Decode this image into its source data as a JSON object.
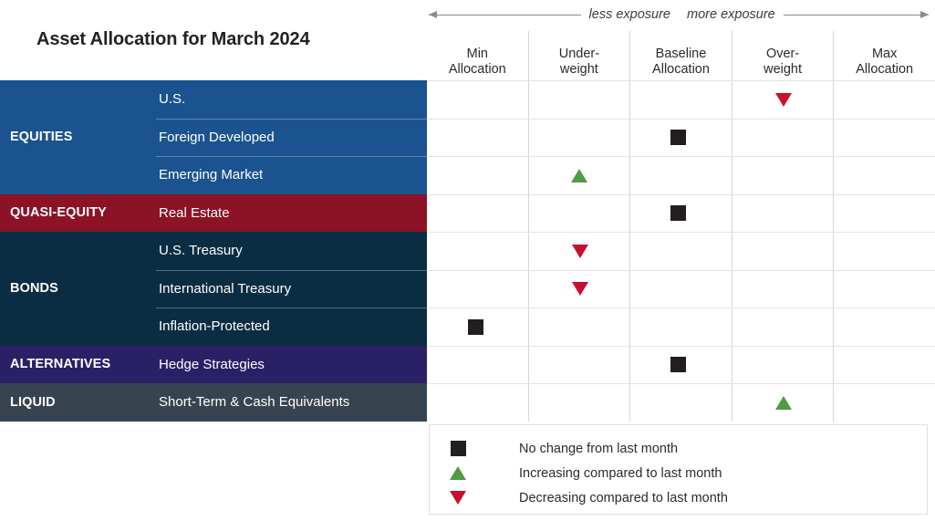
{
  "chart_data": {
    "type": "table",
    "title": "Asset Allocation for March 2024",
    "xlabel": "",
    "ylabel": "",
    "grid": true,
    "legend_position": "bottom-right",
    "axis_direction": {
      "left_label": "less exposure",
      "right_label": "more exposure",
      "left_arrow_icon": "arrow-left-icon",
      "right_arrow_icon": "arrow-right-icon"
    },
    "categories": [
      "Min\nAllocation",
      "Under-\nweight",
      "Baseline\nAllocation",
      "Over-\nweight",
      "Max\nAllocation"
    ],
    "series": [
      {
        "name": "U.S.",
        "group": "EQUITIES",
        "column": "Over-weight",
        "column_index": 3,
        "marker": "down",
        "value": 4
      },
      {
        "name": "Foreign Developed",
        "group": "EQUITIES",
        "column": "Baseline Allocation",
        "column_index": 2,
        "marker": "square",
        "value": 3
      },
      {
        "name": "Emerging Market",
        "group": "EQUITIES",
        "column": "Under-weight",
        "column_index": 1,
        "marker": "up",
        "value": 2
      },
      {
        "name": "Real Estate",
        "group": "QUASI-EQUITY",
        "column": "Baseline Allocation",
        "column_index": 2,
        "marker": "square",
        "value": 3
      },
      {
        "name": "U.S. Treasury",
        "group": "BONDS",
        "column": "Under-weight",
        "column_index": 1,
        "marker": "down",
        "value": 2
      },
      {
        "name": "International Treasury",
        "group": "BONDS",
        "column": "Under-weight",
        "column_index": 1,
        "marker": "down",
        "value": 2
      },
      {
        "name": "Inflation-Protected",
        "group": "BONDS",
        "column": "Min Allocation",
        "column_index": 0,
        "marker": "square",
        "value": 1
      },
      {
        "name": "Hedge Strategies",
        "group": "ALTERNATIVES",
        "column": "Baseline Allocation",
        "column_index": 2,
        "marker": "square",
        "value": 3
      },
      {
        "name": "Short-Term & Cash Equivalents",
        "group": "LIQUID",
        "column": "Over-weight",
        "column_index": 3,
        "marker": "up",
        "value": 4
      }
    ]
  },
  "title": "Asset Allocation for March 2024",
  "exposure": {
    "less": "less exposure",
    "more": "more exposure"
  },
  "columns": [
    {
      "line1": "Min",
      "line2": "Allocation"
    },
    {
      "line1": "Under-",
      "line2": "weight"
    },
    {
      "line1": "Baseline",
      "line2": "Allocation"
    },
    {
      "line1": "Over-",
      "line2": "weight"
    },
    {
      "line1": "Max",
      "line2": "Allocation"
    }
  ],
  "groups": [
    {
      "label": "EQUITIES",
      "color": "#1a538f",
      "rows": 3
    },
    {
      "label": "QUASI-EQUITY",
      "color": "#8c1226",
      "rows": 1
    },
    {
      "label": "BONDS",
      "color": "#0b2d43",
      "rows": 3
    },
    {
      "label": "ALTERNATIVES",
      "color": "#2a2066",
      "rows": 1
    },
    {
      "label": "LIQUID",
      "color": "#374450",
      "rows": 1
    }
  ],
  "rows": [
    {
      "group": "EQUITIES",
      "group_label_shown": false,
      "asset": "U.S.",
      "marker": "down",
      "col": 3,
      "rule": false
    },
    {
      "group": "EQUITIES",
      "group_label_shown": true,
      "asset": "Foreign Developed",
      "marker": "square",
      "col": 2,
      "rule": true
    },
    {
      "group": "EQUITIES",
      "group_label_shown": false,
      "asset": "Emerging Market",
      "marker": "up",
      "col": 1,
      "rule": true
    },
    {
      "group": "QUASI-EQUITY",
      "group_label_shown": true,
      "asset": "Real Estate",
      "marker": "square",
      "col": 2,
      "rule": false
    },
    {
      "group": "BONDS",
      "group_label_shown": false,
      "asset": "U.S. Treasury",
      "marker": "down",
      "col": 1,
      "rule": false
    },
    {
      "group": "BONDS",
      "group_label_shown": true,
      "asset": "International Treasury",
      "marker": "down",
      "col": 1,
      "rule": true
    },
    {
      "group": "BONDS",
      "group_label_shown": false,
      "asset": "Inflation-Protected",
      "marker": "square",
      "col": 0,
      "rule": true
    },
    {
      "group": "ALTERNATIVES",
      "group_label_shown": true,
      "asset": "Hedge Strategies",
      "marker": "square",
      "col": 2,
      "rule": false
    },
    {
      "group": "LIQUID",
      "group_label_shown": true,
      "asset": "Short-Term & Cash Equivalents",
      "marker": "up",
      "col": 3,
      "rule": false
    }
  ],
  "legend": [
    {
      "marker": "square",
      "icon": "black-square-icon",
      "text": "No change from last month"
    },
    {
      "marker": "up",
      "icon": "green-up-triangle-icon",
      "text": "Increasing compared to last month"
    },
    {
      "marker": "down",
      "icon": "red-down-triangle-icon",
      "text": "Decreasing compared to last month"
    }
  ],
  "colors": {
    "equities": "#1a538f",
    "quasi_equity": "#8c1226",
    "bonds": "#0b2d43",
    "alternatives": "#2a2066",
    "liquid": "#374450",
    "no_change": "#231f20",
    "increasing": "#4f9c3f",
    "decreasing": "#c8102e",
    "grid": "#d6d6d6"
  }
}
